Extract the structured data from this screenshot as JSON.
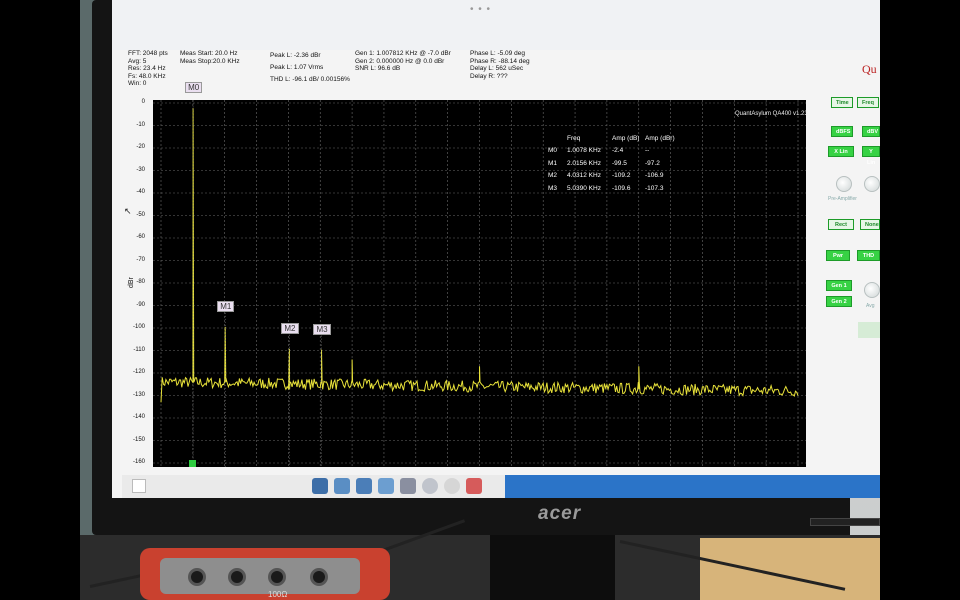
{
  "monitor": {
    "brand": "acer"
  },
  "device": {
    "label": "100Ω"
  },
  "topbar": {
    "dots": "• • •"
  },
  "header": {
    "col1": [
      "FFT: 2048 pts",
      "Avg: 5",
      "Res: 23.4 Hz",
      "Fs: 48.0 KHz",
      "Win: 0"
    ],
    "col2": [
      "Meas Start: 20.0 Hz",
      "Meas Stop:20.0 KHz"
    ],
    "col3": [
      "Peak L: -2.36 dBr",
      "Peak L: 1.07 Vrms",
      "THD L: -96.1 dB/ 0.00156%"
    ],
    "col4": [
      "Gen 1: 1.007812 KHz @ -7.0 dBr",
      "Gen 2: 0.000000 Hz @ 0.0 dBr",
      "SNR L: 96.6 dB"
    ],
    "col5": [
      "Phase L: -5.09 deg",
      "Phase R: -88.14 deg",
      "Delay L: 562 uSec",
      "Delay R: ???"
    ],
    "app_title": "Qu"
  },
  "plot": {
    "version": "QuantAsylum QA400 v1.23",
    "y_unit": "dBr",
    "y_ticks": [
      "0",
      "-10",
      "-20",
      "-30",
      "-40",
      "-50",
      "-60",
      "-70",
      "-80",
      "-90",
      "-100",
      "-110",
      "-120",
      "-130",
      "-140",
      "-150",
      "-160"
    ]
  },
  "marker_table": {
    "headers": [
      "",
      "Freq",
      "Amp (dB)",
      "Amp (dBr)"
    ],
    "rows": [
      [
        "M0",
        "1.0078 KHz",
        "-2.4",
        "--"
      ],
      [
        "M1",
        "2.0156 KHz",
        "-99.5",
        "-97.2"
      ],
      [
        "M2",
        "4.0312 KHz",
        "-109.2",
        "-106.9"
      ],
      [
        "M3",
        "5.0390 KHz",
        "-109.6",
        "-107.3"
      ]
    ]
  },
  "markers": [
    {
      "label": "M0",
      "freq_hz": 1007.8,
      "amp_db": -2.4
    },
    {
      "label": "M1",
      "freq_hz": 2015.6,
      "amp_db": -99.5
    },
    {
      "label": "M2",
      "freq_hz": 4031.2,
      "amp_db": -109.2
    },
    {
      "label": "M3",
      "freq_hz": 5039.0,
      "amp_db": -109.6
    }
  ],
  "chart_data": {
    "type": "line",
    "xlabel": "",
    "ylabel": "dBr",
    "ylim": [
      -160,
      0
    ],
    "grid": true,
    "series": [
      {
        "values_desc": "",
        "peaks": [
          {
            "label": "M0",
            "freq_hz": 1007.8,
            "amp_db": -2.4
          },
          {
            "label": "M1",
            "freq_hz": 2015.6,
            "amp_db": -99.5
          },
          {
            "label": "M2",
            "freq_hz": 4031.2,
            "amp_db": -109.2
          },
          {
            "label": "M3",
            "freq_hz": 5039.0,
            "amp_db": -109.6
          }
        ],
        "noise_floor_db": -124,
        "color": "#e8e23a"
      }
    ]
  },
  "right_panel": {
    "buttons": [
      "Time",
      "Freq",
      "dBFS",
      "dBV",
      "X Lin",
      "Y Lin",
      "Rect",
      "None",
      "Pwr",
      "THD",
      "Gen 1",
      "Gen 2"
    ],
    "knob_label_1": "Pre-Amplifier",
    "knob_label_2": "Avg"
  },
  "colors": {
    "trace": "#e8e23a",
    "grid": "#6a6a6a",
    "button_green": "#37d244",
    "marker_bg": "#eadff0"
  }
}
